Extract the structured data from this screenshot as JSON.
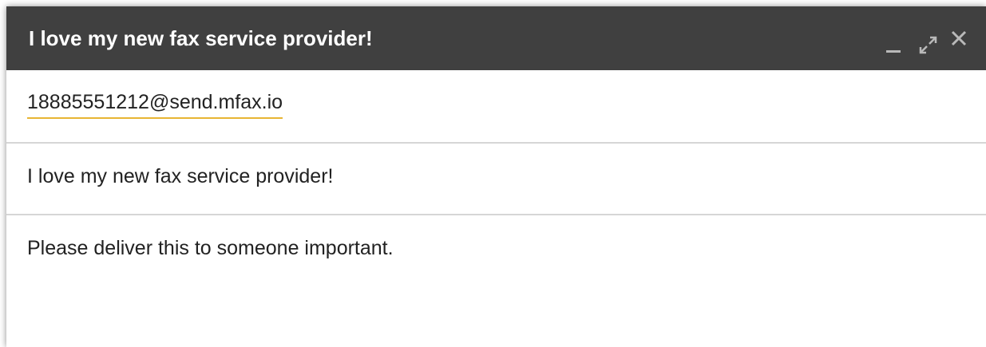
{
  "window": {
    "title": "I love my new fax service provider!",
    "controls": [
      {
        "name": "minimize-icon"
      },
      {
        "name": "expand-icon"
      },
      {
        "name": "close-icon"
      }
    ]
  },
  "to": {
    "recipient": "18885551212@send.mfax.io"
  },
  "subject": {
    "value": "I love my new fax service provider!"
  },
  "body": {
    "value": "Please deliver this to someone important."
  },
  "colors": {
    "titlebar_bg": "#404040",
    "title_text": "#ffffff",
    "recipient_underline": "#e8b533",
    "divider": "#d6d6d6",
    "text": "#222222"
  }
}
